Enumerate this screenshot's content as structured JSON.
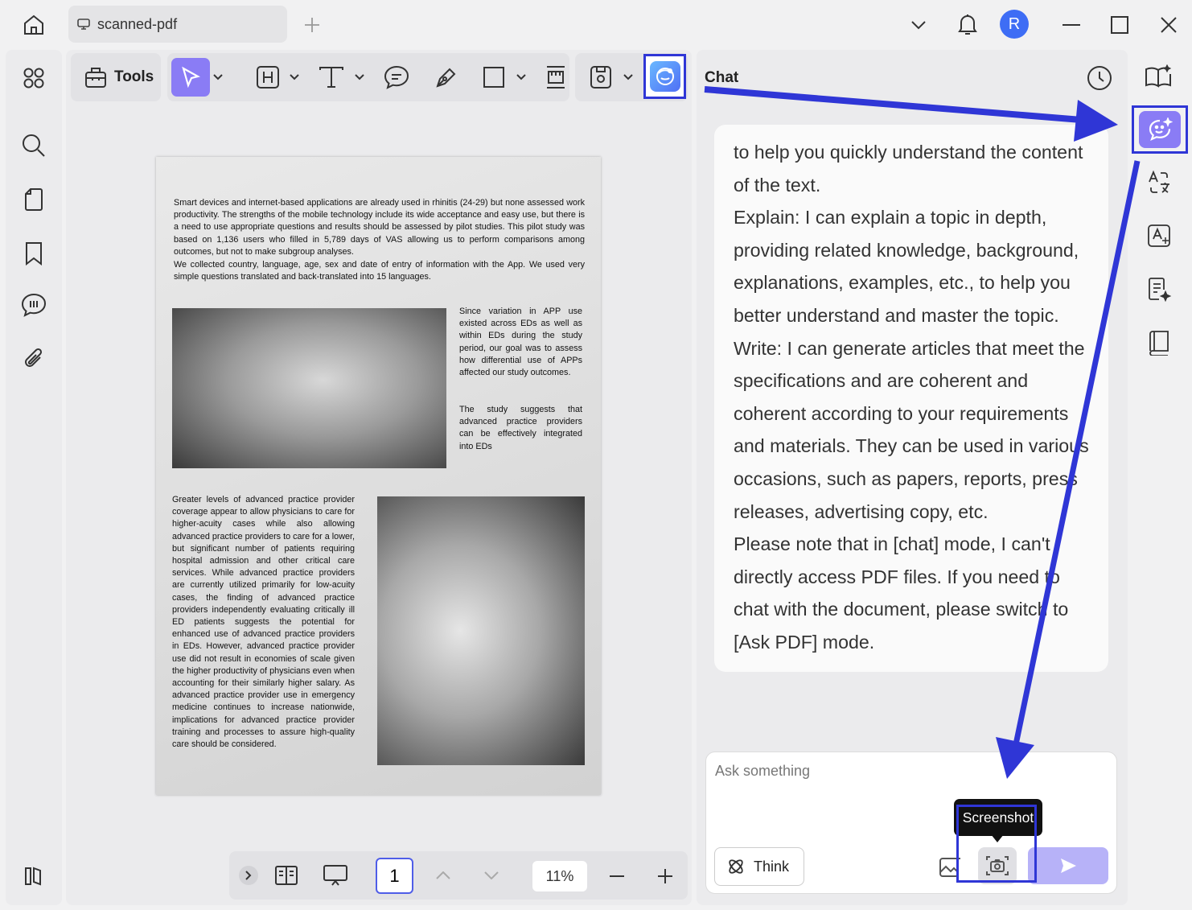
{
  "window": {
    "tab_title": "scanned-pdf",
    "avatar_letter": "R"
  },
  "toolbar": {
    "tools_label": "Tools"
  },
  "document": {
    "para1": "Smart devices and internet-based applications are already used in rhinitis (24-29) but none assessed work productivity. The strengths of the mobile technology include its wide acceptance and easy use, but there is a need to use appropriate questions and results should be assessed by pilot studies. This pilot study was based on 1,136 users who filled in 5,789 days of VAS allowing us to perform comparisons among outcomes, but not to make subgroup analyses.",
    "para2": "We collected country, language, age, sex and date of entry of information with the App. We used very simple questions translated and back-translated into 15 languages.",
    "para3": "Since variation in APP use existed across EDs as well as within EDs during the study period, our goal was to assess how differential use of APPs affected our study outcomes.",
    "para4": "The study suggests that advanced practice providers can be effectively integrated into EDs",
    "para5": "Greater levels of advanced practice provider coverage appear to allow physicians to care for higher-acuity cases while also allowing advanced practice providers to care for a lower, but significant number of patients requiring hospital admission and other critical care services. While advanced practice providers are currently utilized primarily for low-acuity cases, the finding of advanced practice providers independently evaluating critically ill ED patients suggests the potential for enhanced use of advanced practice providers in EDs. However, advanced practice provider use did not result in economies of scale given the higher productivity of physicians even when accounting for their similarly higher salary. As advanced practice provider use in emergency medicine continues to increase nationwide, implications for advanced practice provider training and processes to assure high-quality care should be considered."
  },
  "bottom_bar": {
    "page_number": "1",
    "zoom": "11%"
  },
  "chat": {
    "title": "Chat",
    "message": [
      "to help you quickly understand the content of the text.",
      "Explain: I can explain a topic in depth, providing related knowledge, background, explanations, examples, etc., to help you better understand and master the topic.",
      "Write: I can generate articles that meet the specifications and are coherent and coherent according to your requirements and materials. They can be used in various occasions, such as papers, reports, press releases, advertising copy, etc.",
      "Please note that in [chat] mode, I can't directly access PDF files. If you need to chat with the document, please switch to [Ask PDF] mode."
    ],
    "input_placeholder": "Ask something",
    "think_label": "Think",
    "tooltip": "Screenshot"
  },
  "colors": {
    "accent": "#8a7cf5",
    "annotation": "#2f36d6",
    "send_disabled": "#b7b2f8"
  },
  "icons": [
    "home-icon",
    "monitor-icon",
    "plus-icon",
    "chevron-down-icon",
    "bell-icon",
    "minimize-icon",
    "maximize-icon",
    "close-icon",
    "grid-icon",
    "search-icon",
    "page-icon",
    "bookmark-icon",
    "comment-icon",
    "attachment-icon",
    "sidebar-toggle-icon",
    "toolbox-icon",
    "cursor-icon",
    "heading-icon",
    "text-icon",
    "note-icon",
    "pen-icon",
    "rectangle-icon",
    "ruler-icon",
    "save-icon",
    "ai-assistant-icon",
    "history-icon",
    "read-mode-icon",
    "ai-chat-icon",
    "translate-icon",
    "ocr-icon",
    "summarize-icon",
    "book-icon",
    "think-icon",
    "image-upload-icon",
    "screenshot-icon",
    "send-icon",
    "chevron-right-icon",
    "two-page-icon",
    "presentation-icon",
    "chevron-up-icon",
    "minus-icon"
  ]
}
